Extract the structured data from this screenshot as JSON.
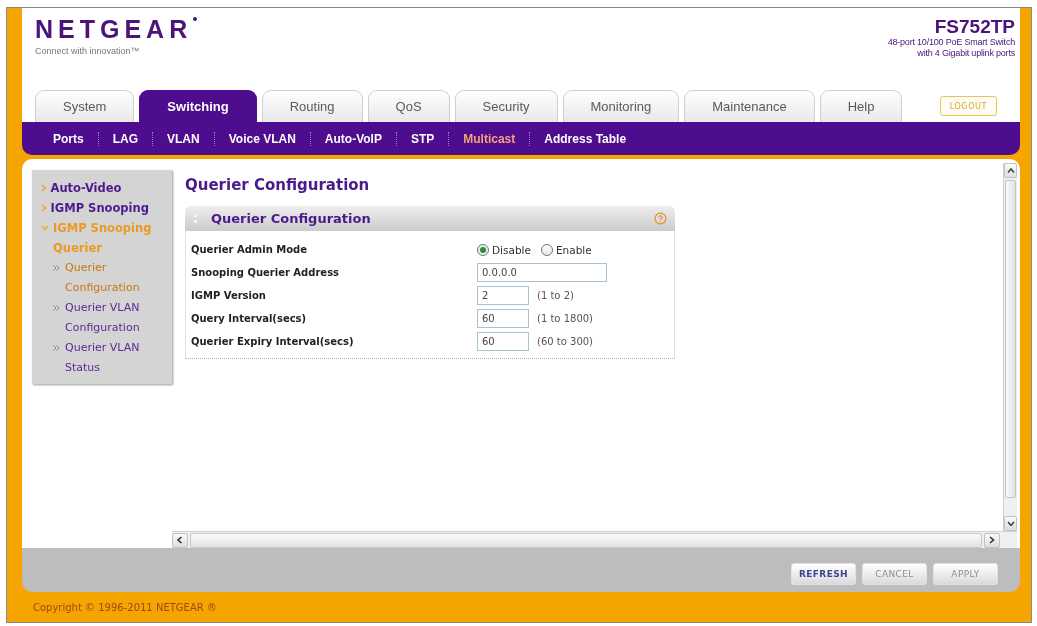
{
  "header": {
    "logo": "NETGEAR",
    "tagline": "Connect with innovation™",
    "model": "FS752TP",
    "description": [
      "48-port 10/100 PoE Smart Switch",
      "with 4 Gigabit uplink ports"
    ],
    "logout": "LOGOUT"
  },
  "tabs": [
    {
      "label": "System",
      "selected": false
    },
    {
      "label": "Switching",
      "selected": true
    },
    {
      "label": "Routing",
      "selected": false
    },
    {
      "label": "QoS",
      "selected": false
    },
    {
      "label": "Security",
      "selected": false
    },
    {
      "label": "Monitoring",
      "selected": false
    },
    {
      "label": "Maintenance",
      "selected": false
    },
    {
      "label": "Help",
      "selected": false
    }
  ],
  "subnav": [
    {
      "label": "Ports",
      "selected": false
    },
    {
      "label": "LAG",
      "selected": false
    },
    {
      "label": "VLAN",
      "selected": false
    },
    {
      "label": "Voice VLAN",
      "selected": false
    },
    {
      "label": "Auto-VoIP",
      "selected": false
    },
    {
      "label": "STP",
      "selected": false
    },
    {
      "label": "Multicast",
      "selected": true
    },
    {
      "label": "Address Table",
      "selected": false
    }
  ],
  "sidebar": [
    {
      "label": "Auto-Video",
      "expanded": false,
      "selected": false
    },
    {
      "label": "IGMP Snooping",
      "expanded": false,
      "selected": false
    },
    {
      "label": "IGMP Snooping Querier",
      "expanded": true,
      "selected": true,
      "children": [
        {
          "label": "Querier Configuration",
          "selected": true
        },
        {
          "label": "Querier VLAN Configuration",
          "selected": false
        },
        {
          "label": "Querier VLAN Status",
          "selected": false
        }
      ]
    }
  ],
  "page_title": "Querier Configuration",
  "panel": {
    "title": "Querier Configuration",
    "rows": [
      {
        "kind": "radio",
        "label": "Querier Admin Mode",
        "options": [
          {
            "label": "Disable",
            "selected": true
          },
          {
            "label": "Enable",
            "selected": false
          }
        ]
      },
      {
        "kind": "text",
        "label": "Snooping Querier Address",
        "value": "0.0.0.0"
      },
      {
        "kind": "number",
        "label": "IGMP Version",
        "value": "2",
        "range": "(1 to 2)"
      },
      {
        "kind": "number",
        "label": "Query Interval(secs)",
        "value": "60",
        "range": "(1 to 1800)"
      },
      {
        "kind": "number",
        "label": "Querier Expiry Interval(secs)",
        "value": "60",
        "range": "(60 to 300)"
      }
    ]
  },
  "buttons": [
    {
      "label": "REFRESH",
      "disabled": false
    },
    {
      "label": "CANCEL",
      "disabled": true
    },
    {
      "label": "APPLY",
      "disabled": true
    }
  ],
  "footer": "Copyright © 1996-2011 NETGEAR ®"
}
